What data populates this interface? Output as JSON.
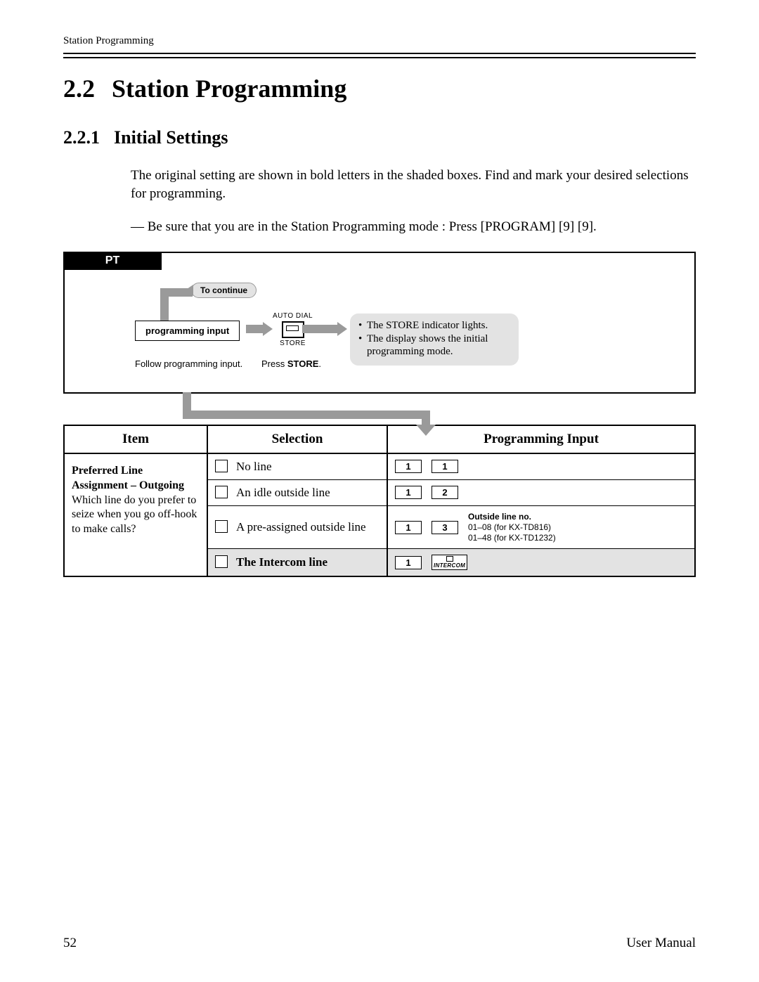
{
  "running_head": "Station Programming",
  "section_number": "2.2",
  "section_title": "Station Programming",
  "subsection_number": "2.2.1",
  "subsection_title": "Initial Settings",
  "intro_para": "The original setting are shown in bold letters in the shaded boxes. Find and mark your desired selections for programming.",
  "mode_note": "— Be sure that you are in the Station Programming mode : Press [PROGRAM] [9] [9].",
  "pt": {
    "tab": "PT",
    "to_continue": "To continue",
    "prog_input_box": "programming input",
    "follow_text": "Follow programming input.",
    "auto_dial": "AUTO DIAL",
    "store": "STORE",
    "press_store_pre": "Press ",
    "press_store_bold": "STORE",
    "press_store_post": ".",
    "callout_line1": "The STORE indicator lights.",
    "callout_line2": "The display shows the initial programming mode."
  },
  "table": {
    "headers": {
      "item": "Item",
      "selection": "Selection",
      "input": "Programming Input"
    },
    "item": {
      "title": "Preferred Line Assignment – Outgoing",
      "desc": "Which line do you prefer to seize when you go off-hook to make calls?"
    },
    "rows": [
      {
        "label": "No line",
        "bold": false,
        "keys": [
          "1",
          "1"
        ],
        "extra": null
      },
      {
        "label": "An idle outside line",
        "bold": false,
        "keys": [
          "1",
          "2"
        ],
        "extra": null
      },
      {
        "label": "A pre-assigned outside line",
        "bold": false,
        "keys": [
          "1",
          "3"
        ],
        "extra": {
          "title": "Outside line no.",
          "l1": "01–08 (for KX-TD816)",
          "l2": "01–48 (for KX-TD1232)"
        }
      },
      {
        "label": "The Intercom line",
        "bold": true,
        "keys": [
          "1",
          "INTERCOM"
        ],
        "extra": null
      }
    ]
  },
  "footer": {
    "page": "52",
    "doc": "User Manual"
  }
}
